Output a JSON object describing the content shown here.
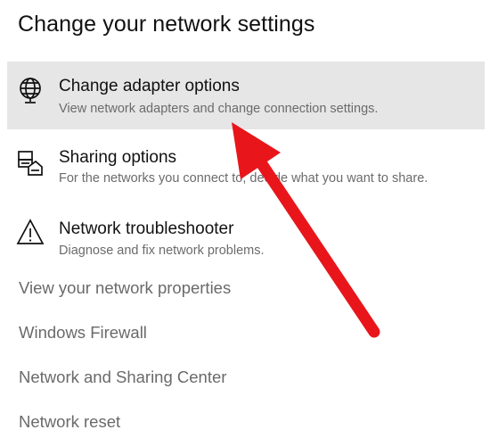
{
  "page": {
    "title": "Change your network settings"
  },
  "options": [
    {
      "title": "Change adapter options",
      "description": "View network adapters and change connection settings.",
      "icon": "globe-icon"
    },
    {
      "title": "Sharing options",
      "description": "For the networks you connect to, decide what you want to share.",
      "icon": "sharing-icon"
    },
    {
      "title": "Network troubleshooter",
      "description": "Diagnose and fix network problems.",
      "icon": "warning-icon"
    }
  ],
  "links": {
    "view_properties": "View your network properties",
    "windows_firewall": "Windows Firewall",
    "sharing_center": "Network and Sharing Center",
    "network_reset": "Network reset"
  },
  "colors": {
    "highlight_background": "#e6e6e6",
    "description_text": "#6b6b6b",
    "link_text": "#6a6a6a",
    "annotation_arrow": "#e8161b"
  }
}
